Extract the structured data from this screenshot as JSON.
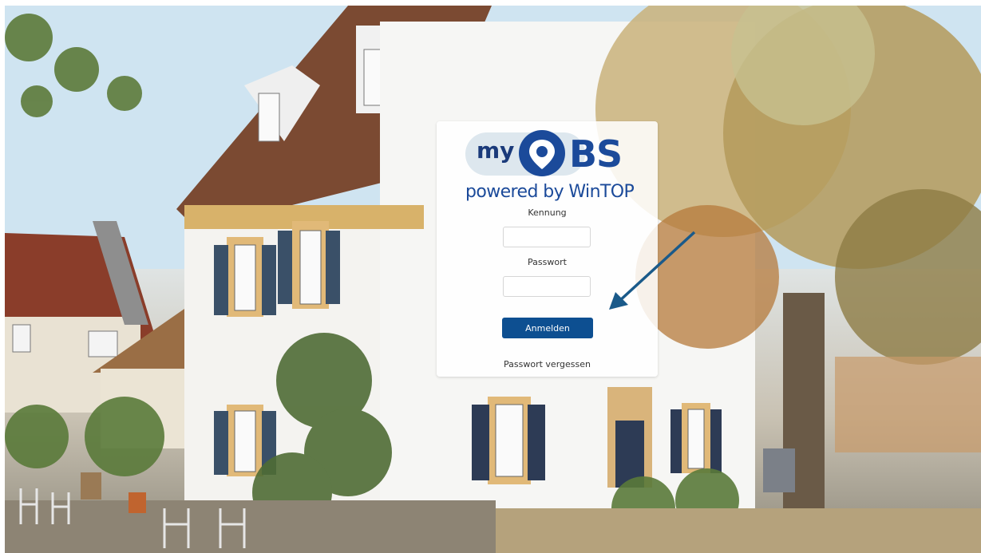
{
  "logo": {
    "my": "my",
    "bs": "BS",
    "tagline": "powered by WinTOP"
  },
  "login": {
    "username_label": "Kennung",
    "username_value": "",
    "password_label": "Passwort",
    "password_value": "",
    "submit_label": "Anmelden",
    "forgot_label": "Passwort vergessen"
  },
  "colors": {
    "brand_blue": "#1b4a9a",
    "button_blue": "#0d4f91",
    "arrow_blue": "#1a5a8a"
  },
  "icons": {
    "logo_pin": "location-pin-icon",
    "annotation": "arrow-icon"
  }
}
